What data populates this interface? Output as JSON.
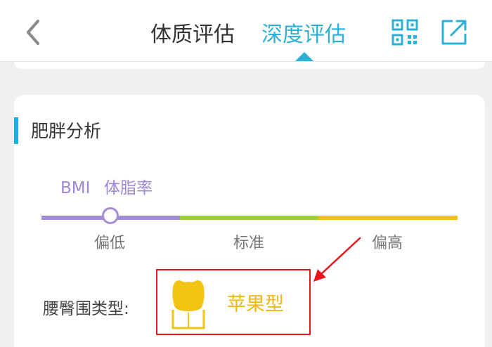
{
  "header": {
    "tabs": [
      {
        "label": "体质评估",
        "active": false
      },
      {
        "label": "深度评估",
        "active": true
      }
    ],
    "icons": [
      "back-icon",
      "qr-code-icon",
      "share-icon"
    ]
  },
  "section": {
    "title": "肥胖分析",
    "legend": [
      "BMI",
      "体脂率"
    ],
    "scale_labels": [
      "偏低",
      "标准",
      "偏高"
    ],
    "scale_colors": [
      "#a48bd8",
      "#9ccf3a",
      "#f3c313"
    ],
    "marker_segment": "偏低"
  },
  "waist_hip": {
    "label": "腰臀围类型:",
    "value": "苹果型",
    "icon": "apple-shape-icon"
  },
  "colors": {
    "accent": "#2bb0d8",
    "annotation": "#e8141c",
    "value": "#f0b80f"
  }
}
